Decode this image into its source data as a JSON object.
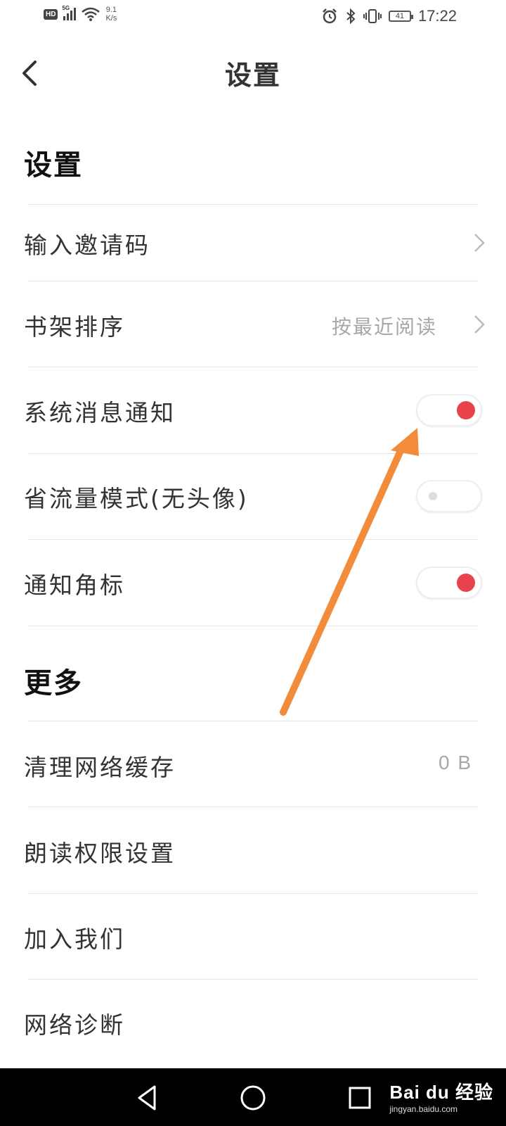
{
  "status_bar": {
    "network_badge": "HD",
    "network_type": "5G",
    "speed_value": "9.1",
    "speed_unit": "K/s",
    "battery": "41",
    "time": "17:22"
  },
  "header": {
    "title": "设置"
  },
  "sections": {
    "settings": {
      "title": "设置",
      "rows": [
        {
          "label": "输入邀请码",
          "value": ""
        },
        {
          "label": "书架排序",
          "value": "按最近阅读"
        },
        {
          "label": "系统消息通知",
          "toggle": true
        },
        {
          "label": "省流量模式(无头像)",
          "toggle": false
        },
        {
          "label": "通知角标",
          "toggle": true
        }
      ]
    },
    "more": {
      "title": "更多",
      "rows": [
        {
          "label": "清理网络缓存",
          "value": "0 B"
        },
        {
          "label": "朗读权限设置"
        },
        {
          "label": "加入我们"
        },
        {
          "label": "网络诊断"
        }
      ]
    }
  },
  "colors": {
    "toggle_on": "#e8434a",
    "annotation_arrow": "#f28c3a"
  },
  "watermark": {
    "brand": "Bai du 经验",
    "url": "jingyan.baidu.com"
  }
}
